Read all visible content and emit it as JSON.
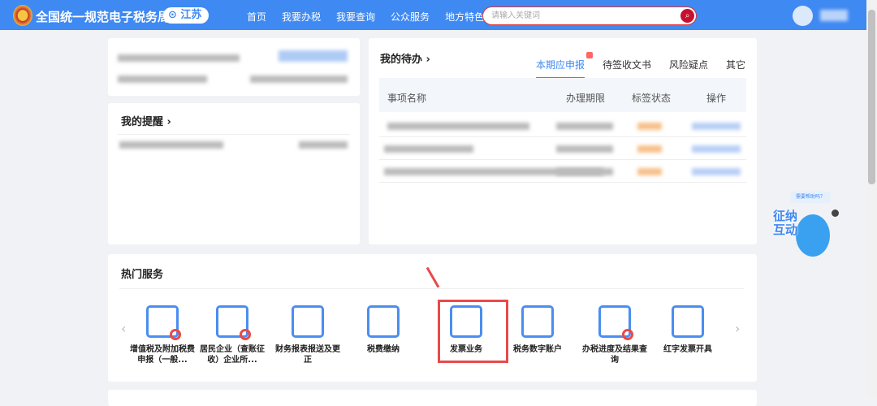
{
  "header": {
    "title": "全国统一规范电子税务局",
    "region": "江苏",
    "nav": [
      "首页",
      "我要办税",
      "我要查询",
      "公众服务",
      "地方特色"
    ],
    "search_placeholder": "请输入关键词"
  },
  "reminder": {
    "title": "我的提醒 ›"
  },
  "todo": {
    "title": "我的待办 ›",
    "tabs": [
      "本期应申报",
      "待签收文书",
      "风险疑点",
      "其它"
    ],
    "columns": [
      "事项名称",
      "办理期限",
      "标签状态",
      "操作"
    ]
  },
  "hot": {
    "title": "热门服务",
    "items": [
      {
        "label": "增值税及附加税费申报（一般...",
        "icon": "declare-icon"
      },
      {
        "label": "居民企业（查账征收）企业所...",
        "icon": "calendar-search-icon"
      },
      {
        "label": "财务报表报送及更正",
        "icon": "report-icon"
      },
      {
        "label": "税费缴纳",
        "icon": "pay-icon"
      },
      {
        "label": "发票业务",
        "icon": "invoice-icon"
      },
      {
        "label": "税务数字账户",
        "icon": "account-123-icon"
      },
      {
        "label": "办税进度及结果查询",
        "icon": "checklist-search-icon"
      },
      {
        "label": "红字发票开具",
        "icon": "printer-red-icon"
      }
    ]
  },
  "assistant": {
    "bubble": "需要帮助吗？",
    "label": "征纳互动"
  },
  "colors": {
    "brand": "#3f89f2",
    "highlight": "#e84a4a"
  }
}
